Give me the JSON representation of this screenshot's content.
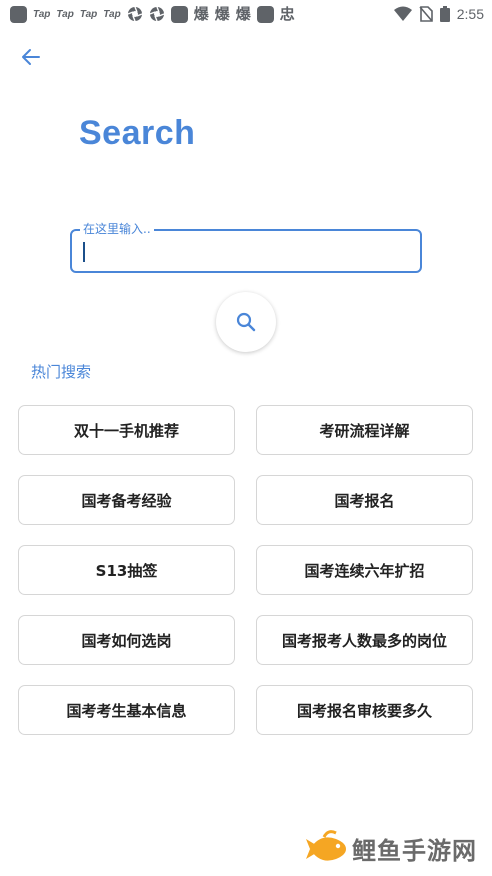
{
  "status_bar": {
    "tap_labels": [
      "Tap",
      "Tap",
      "Tap",
      "Tap"
    ],
    "glyph_labels": [
      "爆",
      "爆",
      "爆"
    ],
    "app_glyph": "忠",
    "time": "2:55"
  },
  "header": {
    "title": "Search"
  },
  "search": {
    "placeholder": "在这里输入..",
    "value": ""
  },
  "hot": {
    "label": "热门搜索",
    "items": [
      "双十一手机推荐",
      "考研流程详解",
      "国考备考经验",
      "国考报名",
      "S13抽签",
      "国考连续六年扩招",
      "国考如何选岗",
      "国考报考人数最多的岗位",
      "国考考生基本信息",
      "国考报名审核要多久"
    ]
  },
  "watermark": {
    "text": "鲤鱼手游网"
  },
  "colors": {
    "accent": "#4a86d8",
    "fish": "#f5a623"
  }
}
